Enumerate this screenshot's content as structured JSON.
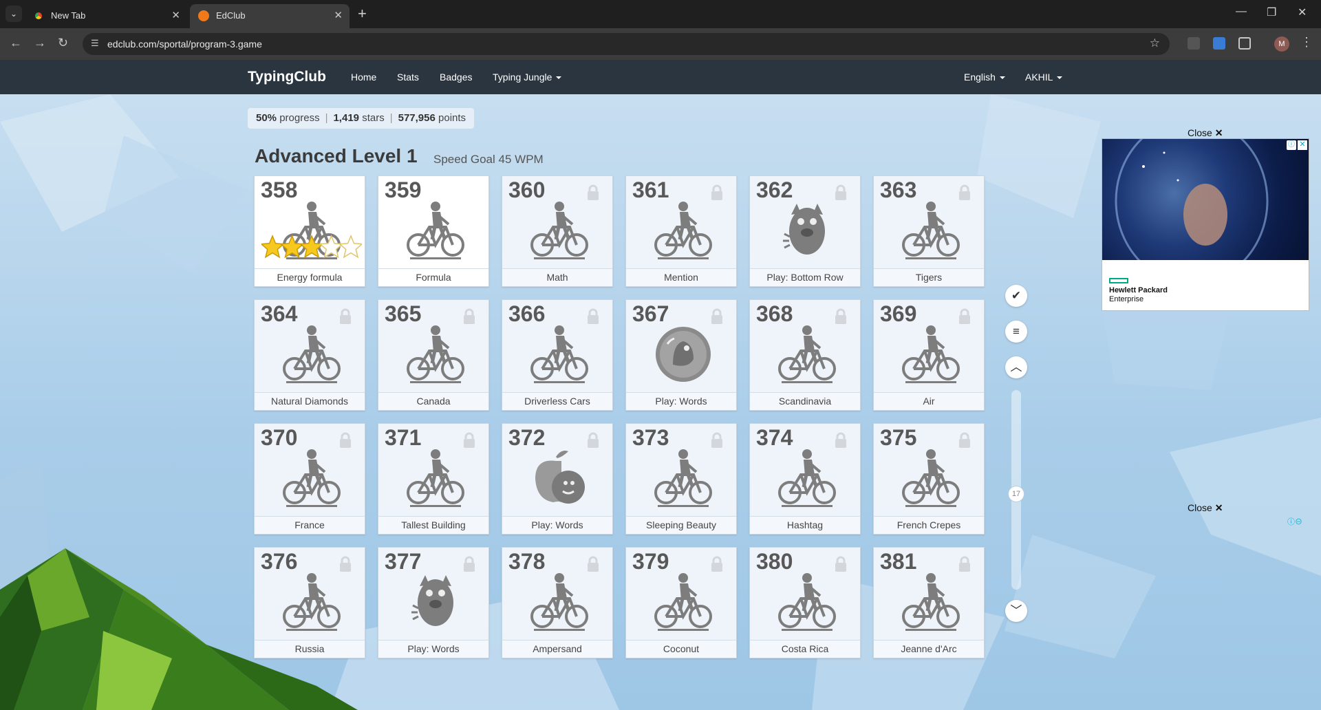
{
  "browser": {
    "tabs": [
      {
        "title": "New Tab",
        "active": false
      },
      {
        "title": "EdClub",
        "active": true
      }
    ],
    "url": "edclub.com/sportal/program-3.game",
    "profile_initial": "M"
  },
  "nav": {
    "brand": "TypingClub",
    "links": [
      "Home",
      "Stats",
      "Badges",
      "Typing Jungle"
    ],
    "language": "English",
    "user": "AKHIL"
  },
  "stats": {
    "progress_value": "50%",
    "progress_label": "progress",
    "stars_value": "1,419",
    "stars_label": "stars",
    "points_value": "577,956",
    "points_label": "points"
  },
  "level": {
    "title": "Advanced Level 1",
    "goal": "Speed Goal 45 WPM"
  },
  "lessons": [
    {
      "num": "358",
      "title": "Energy formula",
      "locked": false,
      "icon": "bike-icon",
      "stars": 3
    },
    {
      "num": "359",
      "title": "Formula",
      "locked": false,
      "icon": "bike-icon"
    },
    {
      "num": "360",
      "title": "Math",
      "locked": true,
      "icon": "bike-icon"
    },
    {
      "num": "361",
      "title": "Mention",
      "locked": true,
      "icon": "bike-icon"
    },
    {
      "num": "362",
      "title": "Play: Bottom Row",
      "locked": true,
      "icon": "monster-icon"
    },
    {
      "num": "363",
      "title": "Tigers",
      "locked": true,
      "icon": "bike-icon"
    },
    {
      "num": "364",
      "title": "Natural Diamonds",
      "locked": true,
      "icon": "bike-icon"
    },
    {
      "num": "365",
      "title": "Canada",
      "locked": true,
      "icon": "bike-icon"
    },
    {
      "num": "366",
      "title": "Driverless Cars",
      "locked": true,
      "icon": "bike-icon"
    },
    {
      "num": "367",
      "title": "Play: Words",
      "locked": true,
      "icon": "bubble-game-icon"
    },
    {
      "num": "368",
      "title": "Scandinavia",
      "locked": true,
      "icon": "bike-icon"
    },
    {
      "num": "369",
      "title": "Air",
      "locked": true,
      "icon": "bike-icon"
    },
    {
      "num": "370",
      "title": "France",
      "locked": true,
      "icon": "bike-icon"
    },
    {
      "num": "371",
      "title": "Tallest Building",
      "locked": true,
      "icon": "bike-icon"
    },
    {
      "num": "372",
      "title": "Play: Words",
      "locked": true,
      "icon": "apple-game-icon"
    },
    {
      "num": "373",
      "title": "Sleeping Beauty",
      "locked": true,
      "icon": "bike-icon"
    },
    {
      "num": "374",
      "title": "Hashtag",
      "locked": true,
      "icon": "bike-icon"
    },
    {
      "num": "375",
      "title": "French Crepes",
      "locked": true,
      "icon": "bike-icon"
    },
    {
      "num": "376",
      "title": "Russia",
      "locked": true,
      "icon": "bike-icon"
    },
    {
      "num": "377",
      "title": "Play: Words",
      "locked": true,
      "icon": "monster-icon"
    },
    {
      "num": "378",
      "title": "Ampersand",
      "locked": true,
      "icon": "bike-icon"
    },
    {
      "num": "379",
      "title": "Coconut",
      "locked": true,
      "icon": "bike-icon"
    },
    {
      "num": "380",
      "title": "Costa Rica",
      "locked": true,
      "icon": "bike-icon"
    },
    {
      "num": "381",
      "title": "Jeanne d'Arc",
      "locked": true,
      "icon": "bike-icon"
    }
  ],
  "sidebar_controls": {
    "scroll_position_label": "17"
  },
  "ads": {
    "close_label": "Close",
    "brand_line1": "Hewlett Packard",
    "brand_line2": "Enterprise"
  },
  "colors": {
    "navbar": "#2a3540",
    "star": "#f7c81e",
    "icon_gray": "#808080",
    "hpe_green": "#01a982"
  }
}
